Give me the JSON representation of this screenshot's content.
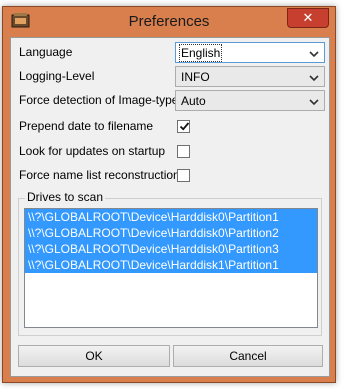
{
  "window": {
    "title": "Preferences",
    "close_glyph": "✕",
    "app_icon": "app-icon"
  },
  "fields": {
    "language": {
      "label": "Language",
      "value": "English"
    },
    "logging_level": {
      "label": "Logging-Level",
      "value": "INFO"
    },
    "force_image_type": {
      "label": "Force detection of Image-type",
      "value": "Auto"
    },
    "prepend_date": {
      "label": "Prepend date to filename",
      "checked": true
    },
    "look_updates": {
      "label": "Look for updates on startup",
      "checked": false
    },
    "force_name_list": {
      "label": "Force name list reconstruction",
      "checked": false
    }
  },
  "drives": {
    "legend": "Drives to scan",
    "items": [
      "\\\\?\\GLOBALROOT\\Device\\Harddisk0\\Partition1",
      "\\\\?\\GLOBALROOT\\Device\\Harddisk0\\Partition2",
      "\\\\?\\GLOBALROOT\\Device\\Harddisk0\\Partition3",
      "\\\\?\\GLOBALROOT\\Device\\Harddisk1\\Partition1"
    ]
  },
  "buttons": {
    "ok": "OK",
    "cancel": "Cancel"
  },
  "colors": {
    "title_bar": "#d97f4e",
    "close": "#c7402f",
    "selection": "#3399ff"
  }
}
